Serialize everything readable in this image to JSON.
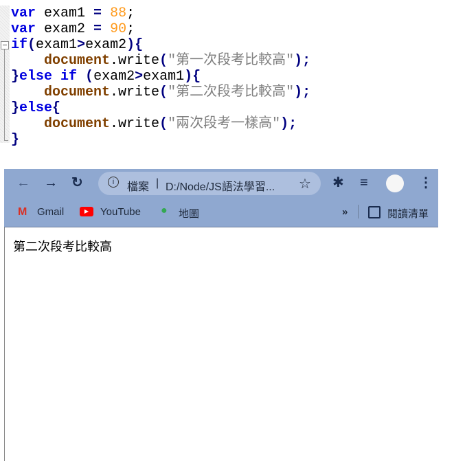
{
  "editor": {
    "lines": [
      [
        {
          "t": "var",
          "c": "kw"
        },
        {
          "t": " exam1 ",
          "c": ""
        },
        {
          "t": "=",
          "c": "op"
        },
        {
          "t": " ",
          "c": ""
        },
        {
          "t": "88",
          "c": "num"
        },
        {
          "t": ";",
          "c": ""
        }
      ],
      [
        {
          "t": "var",
          "c": "kw"
        },
        {
          "t": " exam2 ",
          "c": ""
        },
        {
          "t": "=",
          "c": "op"
        },
        {
          "t": " ",
          "c": ""
        },
        {
          "t": "90",
          "c": "num"
        },
        {
          "t": ";",
          "c": ""
        }
      ],
      [
        {
          "t": "if",
          "c": "kw"
        },
        {
          "t": "(",
          "c": "op"
        },
        {
          "t": "exam1",
          "c": ""
        },
        {
          "t": ">",
          "c": "op"
        },
        {
          "t": "exam2",
          "c": ""
        },
        {
          "t": "){",
          "c": "op"
        }
      ],
      [
        {
          "t": "    ",
          "c": ""
        },
        {
          "t": "document",
          "c": "obj"
        },
        {
          "t": ".write",
          "c": ""
        },
        {
          "t": "(",
          "c": "op"
        },
        {
          "t": "\"第一次段考比較高\"",
          "c": "str"
        },
        {
          "t": ");",
          "c": "op"
        }
      ],
      [
        {
          "t": "}",
          "c": "op"
        },
        {
          "t": "else if",
          "c": "kw"
        },
        {
          "t": " ",
          "c": ""
        },
        {
          "t": "(",
          "c": "op"
        },
        {
          "t": "exam2",
          "c": ""
        },
        {
          "t": ">",
          "c": "op"
        },
        {
          "t": "exam1",
          "c": ""
        },
        {
          "t": "){",
          "c": "op"
        }
      ],
      [
        {
          "t": "    ",
          "c": ""
        },
        {
          "t": "document",
          "c": "obj"
        },
        {
          "t": ".write",
          "c": ""
        },
        {
          "t": "(",
          "c": "op"
        },
        {
          "t": "\"第二次段考比較高\"",
          "c": "str"
        },
        {
          "t": ");",
          "c": "op"
        }
      ],
      [
        {
          "t": "}",
          "c": "op"
        },
        {
          "t": "else",
          "c": "kw"
        },
        {
          "t": "{",
          "c": "op"
        }
      ],
      [
        {
          "t": "    ",
          "c": ""
        },
        {
          "t": "document",
          "c": "obj"
        },
        {
          "t": ".write",
          "c": ""
        },
        {
          "t": "(",
          "c": "op"
        },
        {
          "t": "\"兩次段考一樣高\"",
          "c": "str"
        },
        {
          "t": ");",
          "c": "op"
        }
      ],
      [
        {
          "t": "}",
          "c": "op"
        }
      ]
    ]
  },
  "browser": {
    "address": {
      "scheme_label": "檔案",
      "separator": "|",
      "url": "D:/Node/JS語法學習..."
    },
    "bookmarks": [
      {
        "label": "Gmail",
        "icon": "gmail-icon"
      },
      {
        "label": "YouTube",
        "icon": "youtube-icon"
      },
      {
        "label": "地圖",
        "icon": "maps-icon"
      }
    ],
    "more": "»",
    "reading_list": "閱讀清單",
    "page_text": "第二次段考比較高",
    "colors": {
      "chrome": "#8fa8d0",
      "omnibox": "#adbfde"
    }
  }
}
